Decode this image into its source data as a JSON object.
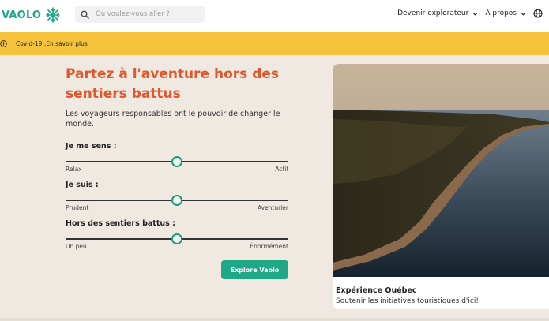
{
  "header": {
    "logo_text": "VAOLO",
    "search_placeholder": "Où voulez-vous aller ?",
    "nav": {
      "become_explorer": "Devenir explorateur",
      "about": "À propos"
    }
  },
  "banner": {
    "prefix": "Covid-19 : ",
    "link": "En savoir plus"
  },
  "hero": {
    "title_line1": "Partez à l'aventure hors des",
    "title_line2": "sentiers battus",
    "subtitle": "Les voyageurs responsables ont le pouvoir de changer le monde."
  },
  "sliders": [
    {
      "label": "Je me sens :",
      "min_label": "Relax",
      "max_label": "Actif",
      "value": 0.5
    },
    {
      "label": "Je suis :",
      "min_label": "Prudent",
      "max_label": "Aventurier",
      "value": 0.5
    },
    {
      "label": "Hors des sentiers battus :",
      "min_label": "Un peu",
      "max_label": "Énormément",
      "value": 0.5
    }
  ],
  "cta_label": "Explore Vaolo",
  "card": {
    "title": "Expérience Québec",
    "description": "Soutenir les initiatives touristiques d'ici!"
  },
  "colors": {
    "brand": "#1fa886",
    "title": "#e2572a",
    "banner": "#f5c33b",
    "background": "#efe9e1"
  },
  "icons": [
    "snowflake-logo-icon",
    "search-icon",
    "chevron-down-icon",
    "globe-icon",
    "info-icon"
  ]
}
